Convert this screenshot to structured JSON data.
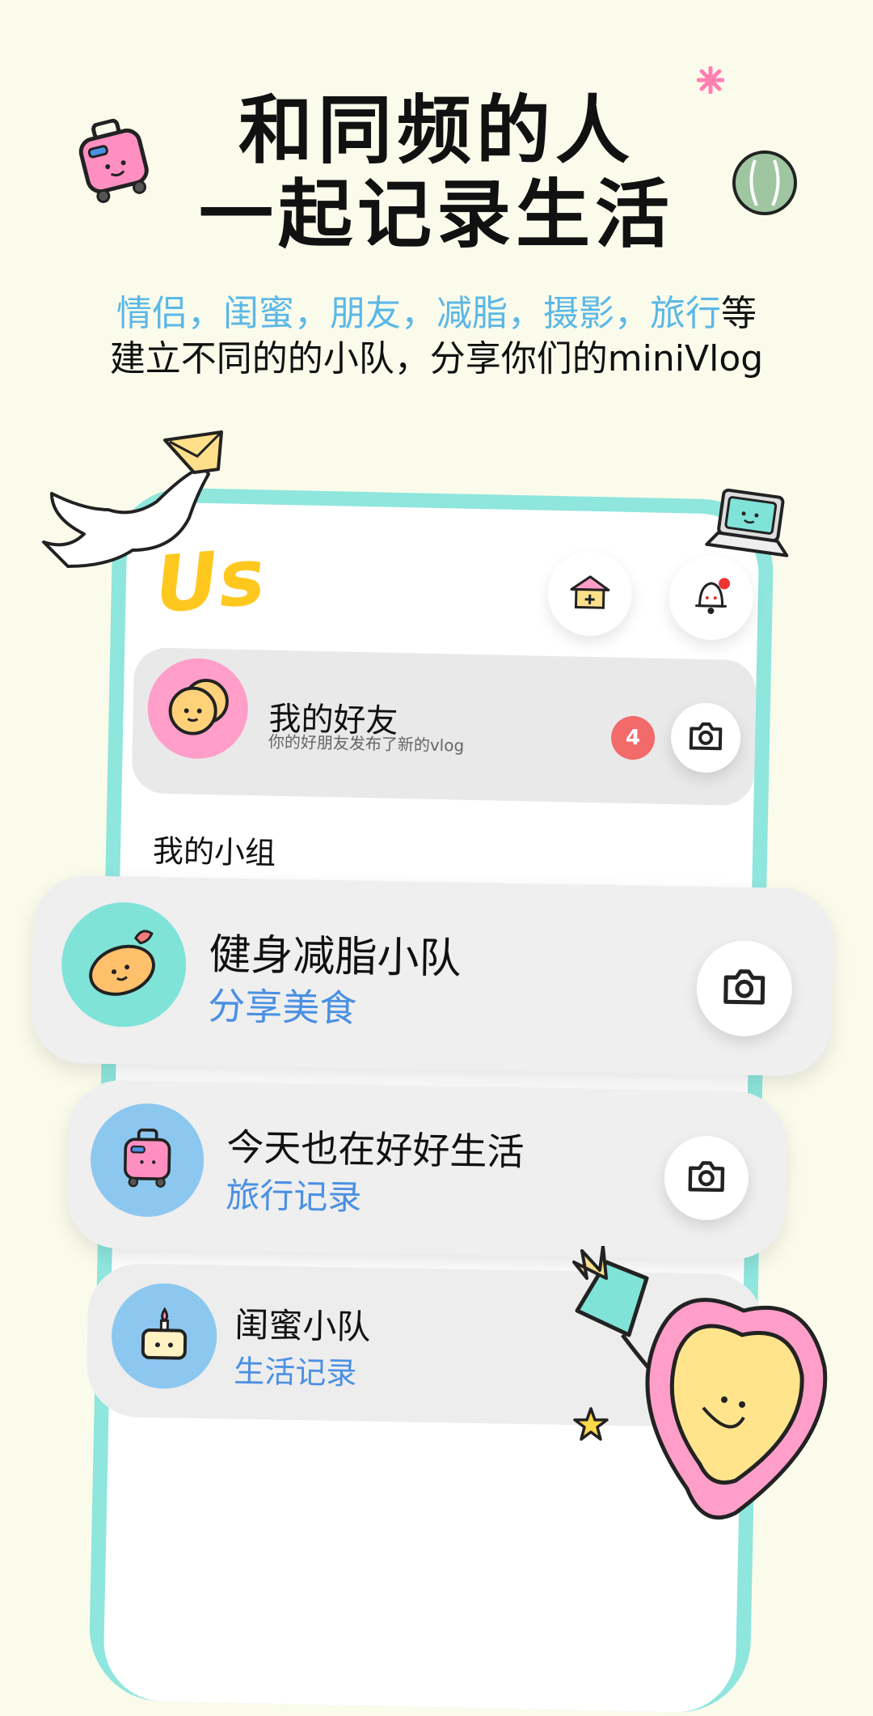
{
  "headline": {
    "line1": "和同频的人",
    "line2": "一起记录生活"
  },
  "subheadline": {
    "tags_text": "情侣，闺蜜，朋友，减脂，摄影，旅行",
    "tags_suffix": "等",
    "line2": "建立不同的的小队，分享你们的miniVlog"
  },
  "app": {
    "logo_text": "Us",
    "header_icons": [
      "add-home-icon",
      "bell-icon"
    ],
    "friends": {
      "title": "我的好友",
      "subtitle": "你的好朋友发布了新的vlog",
      "badge_count": "4",
      "avatar_icon": "cookie-face-icon",
      "avatar_color": "#ff9ec8"
    },
    "groups_heading": "我的小组",
    "groups": [
      {
        "title": "健身减脂小队",
        "subtitle": "分享美食",
        "avatar_icon": "sweet-potato-icon",
        "avatar_color": "#7fe3d8"
      },
      {
        "title": "今天也在好好生活",
        "subtitle": "旅行记录",
        "avatar_icon": "suitcase-icon",
        "avatar_color": "#8cc7ef"
      },
      {
        "title": "闺蜜小队",
        "subtitle": "生活记录",
        "avatar_icon": "cake-icon",
        "avatar_color": "#8cc7ef"
      }
    ]
  },
  "colors": {
    "background": "#fbfbec",
    "phone_frame": "#8ee6dd",
    "accent_blue": "#4a90e2",
    "tag_blue": "#5bb8e6",
    "badge_red": "#f26a6a",
    "logo_yellow": "#ffc81f"
  }
}
